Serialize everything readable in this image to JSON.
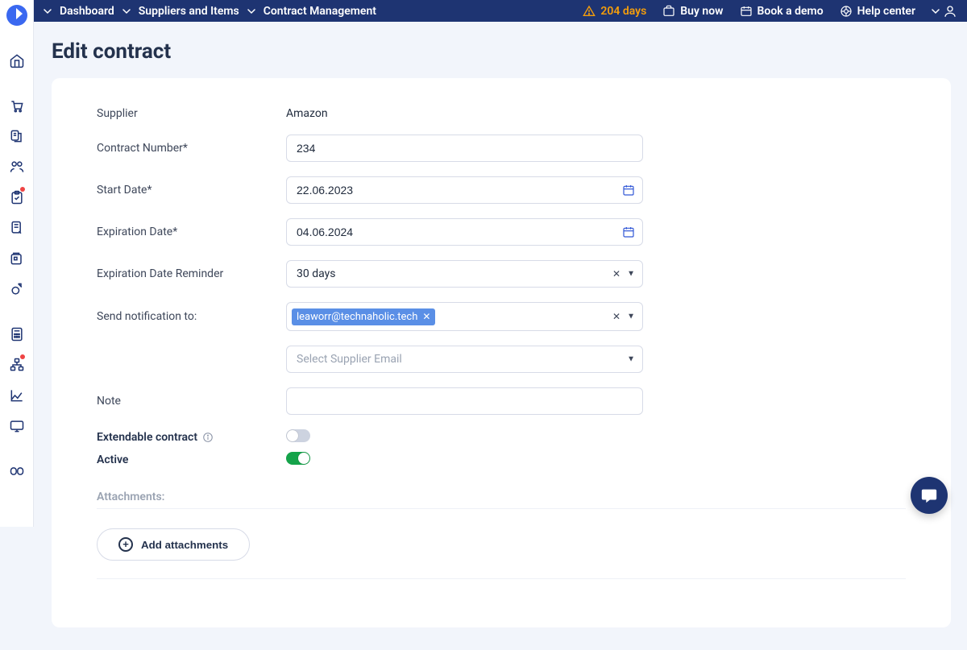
{
  "nav": {
    "crumbs": [
      "Dashboard",
      "Suppliers and Items",
      "Contract Management"
    ]
  },
  "topbar": {
    "trial_days": "204 days",
    "buy_now": "Buy now",
    "book_demo": "Book a demo",
    "help_center": "Help center"
  },
  "page": {
    "title": "Edit contract"
  },
  "form": {
    "labels": {
      "supplier": "Supplier",
      "contract_number": "Contract Number*",
      "start_date": "Start Date*",
      "expiration_date": "Expiration Date*",
      "expiration_reminder": "Expiration Date Reminder",
      "send_notification": "Send notification to:",
      "note": "Note",
      "extendable": "Extendable contract",
      "active": "Active",
      "attachments": "Attachments:",
      "add_attachments": "Add attachments",
      "supplier_email_placeholder": "Select Supplier Email"
    },
    "values": {
      "supplier": "Amazon",
      "contract_number": "234",
      "start_date": "22.06.2023",
      "expiration_date": "04.06.2024",
      "expiration_reminder": "30 days",
      "notification_chip": "leaworr@technaholic.tech",
      "note": "",
      "extendable": false,
      "active": true
    }
  }
}
